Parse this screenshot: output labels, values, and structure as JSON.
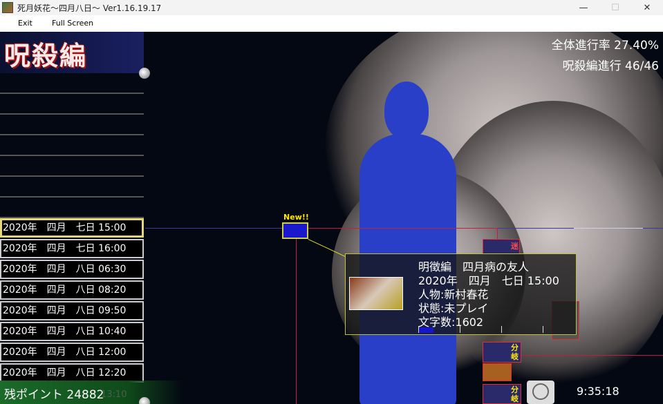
{
  "window": {
    "title": "死月妖花～四月八日～ Ver1.16.19.17",
    "minimize": "—",
    "maximize": "☐",
    "close": "✕"
  },
  "menu": {
    "exit": "Exit",
    "fullscreen": "Full Screen"
  },
  "chapter": {
    "title": "呪殺編"
  },
  "stats": {
    "overall": "全体進行率  27.40%",
    "chapter": "呪殺編進行 46/46"
  },
  "scenes": [
    {
      "label": "2020年　四月　七日 15:00",
      "selected": true
    },
    {
      "label": "2020年　四月　七日 16:00",
      "selected": false
    },
    {
      "label": "2020年　四月　八日 06:30",
      "selected": false
    },
    {
      "label": "2020年　四月　八日 08:20",
      "selected": false
    },
    {
      "label": "2020年　四月　八日 09:50",
      "selected": false
    },
    {
      "label": "2020年　四月　八日 10:40",
      "selected": false
    },
    {
      "label": "2020年　四月　八日 12:00",
      "selected": false
    },
    {
      "label": "2020年　四月　八日 12:20",
      "selected": false
    }
  ],
  "points": {
    "label": "残ポイント 24882",
    "ghost_time": "13:10"
  },
  "node": {
    "badge": "New!!"
  },
  "popup": {
    "chapter_line": "明徴編　四月病の友人",
    "date_line": "2020年　四月　七日 15:00",
    "person_line": "人物:新村春花",
    "status_line": "状態:未プレイ",
    "chars_line": "文字数:1602",
    "progress": 0.12
  },
  "branches": {
    "top_label": "迷",
    "label_1": "分",
    "label_2": "岐",
    "label_3": "分",
    "label_4": "岐"
  },
  "clock": {
    "time": "9:35:18"
  },
  "colors": {
    "silhouette": "#2a3fc8",
    "accent_yellow": "#e6d77a",
    "branch_red": "#e03030",
    "points_green": "#1b6b2a"
  }
}
